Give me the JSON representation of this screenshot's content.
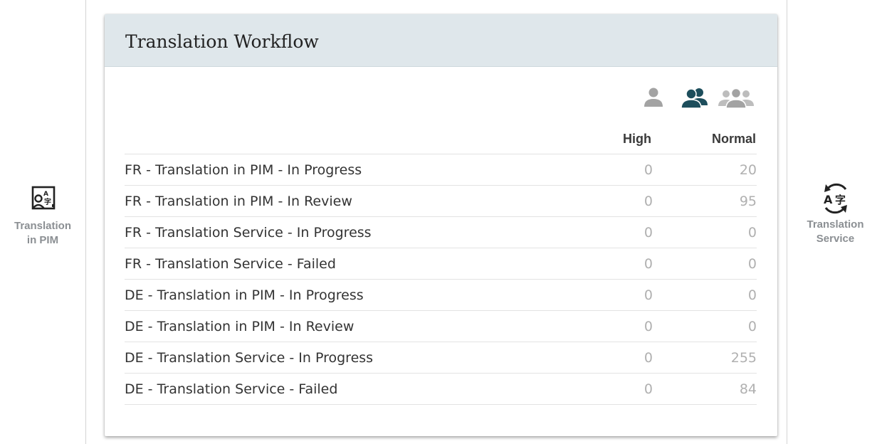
{
  "left_panel": {
    "icon": "translation-person-icon",
    "line1": "Translation",
    "line2": "in PIM"
  },
  "right_panel": {
    "icon": "translate-arrows-icon",
    "line1": "Translation",
    "line2": "Service"
  },
  "card": {
    "title": "Translation Workflow",
    "priority_icons": [
      "single-user-icon",
      "two-users-icon",
      "group-users-icon"
    ],
    "columns": {
      "high": "High",
      "normal": "Normal"
    },
    "rows": [
      {
        "label": "FR - Translation in PIM - In Progress",
        "high": "0",
        "normal": "20"
      },
      {
        "label": "FR - Translation in PIM - In Review",
        "high": "0",
        "normal": "95"
      },
      {
        "label": "FR - Translation Service - In Progress",
        "high": "0",
        "normal": "0"
      },
      {
        "label": "FR - Translation Service - Failed",
        "high": "0",
        "normal": "0"
      },
      {
        "label": "DE - Translation in PIM - In Progress",
        "high": "0",
        "normal": "0"
      },
      {
        "label": "DE - Translation in PIM - In Review",
        "high": "0",
        "normal": "0"
      },
      {
        "label": "DE - Translation Service - In Progress",
        "high": "0",
        "normal": "255"
      },
      {
        "label": "DE - Translation Service - Failed",
        "high": "0",
        "normal": "84"
      }
    ]
  },
  "colors": {
    "header_bg": "#dfe7eb",
    "active_icon": "#1d4e5c",
    "inactive_icon": "#a3a3a3",
    "side_label": "#8b8f93"
  }
}
